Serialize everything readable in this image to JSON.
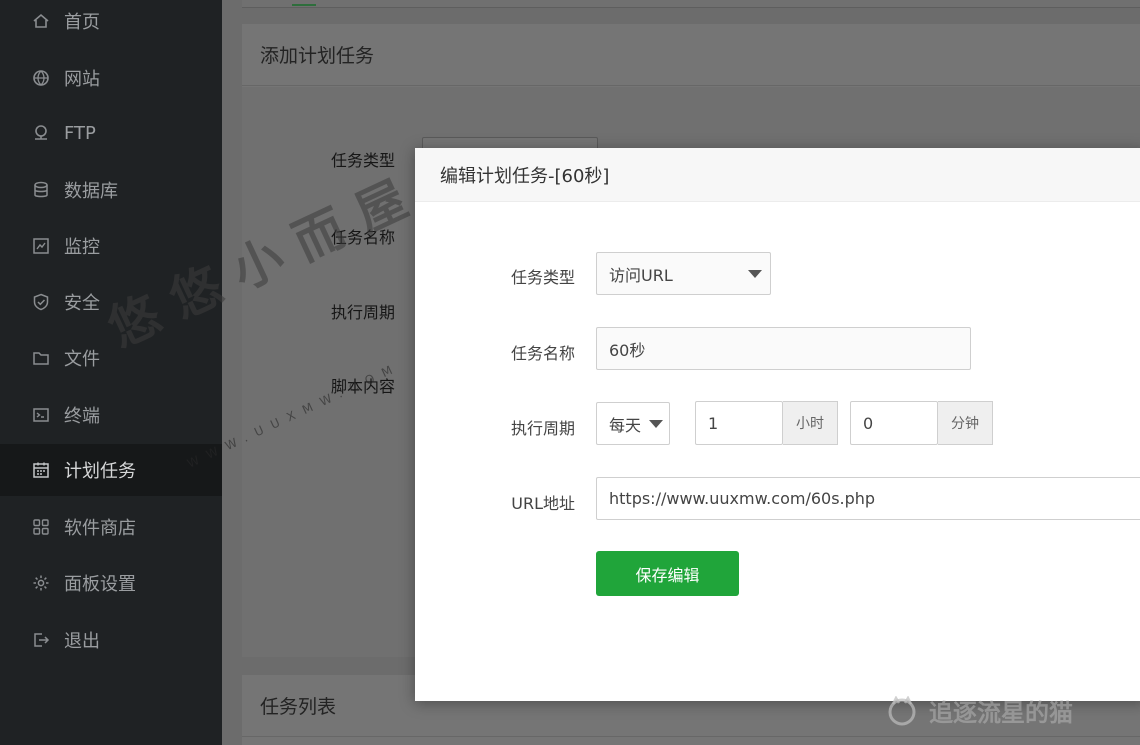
{
  "sidebar": {
    "items": [
      {
        "label": "首页",
        "icon": "home-icon"
      },
      {
        "label": "网站",
        "icon": "globe-icon"
      },
      {
        "label": "FTP",
        "icon": "ftp-icon"
      },
      {
        "label": "数据库",
        "icon": "database-icon"
      },
      {
        "label": "监控",
        "icon": "monitor-icon"
      },
      {
        "label": "安全",
        "icon": "shield-icon"
      },
      {
        "label": "文件",
        "icon": "folder-icon"
      },
      {
        "label": "终端",
        "icon": "terminal-icon"
      },
      {
        "label": "计划任务",
        "icon": "calendar-icon",
        "active": true
      },
      {
        "label": "软件商店",
        "icon": "grid-icon"
      },
      {
        "label": "面板设置",
        "icon": "gear-icon"
      },
      {
        "label": "退出",
        "icon": "logout-icon"
      }
    ]
  },
  "background": {
    "add_panel_title": "添加计划任务",
    "labels": [
      "任务类型",
      "任务名称",
      "执行周期",
      "脚本内容"
    ],
    "list_panel_title": "任务列表"
  },
  "modal": {
    "title": "编辑计划任务-[60秒]",
    "task_type_label": "任务类型",
    "task_type_value": "访问URL",
    "task_name_label": "任务名称",
    "task_name_value": "60秒",
    "cycle_label": "执行周期",
    "cycle_value": "每天",
    "hour_value": "1",
    "hour_unit": "小时",
    "minute_value": "0",
    "minute_unit": "分钟",
    "url_label": "URL地址",
    "url_value": "https://www.uuxmw.com/60s.php",
    "save_label": "保存编辑"
  },
  "watermarks": {
    "big": "悠悠小而屋",
    "small": "WWW.UUXMW.COM",
    "corner": "追逐流星的猫"
  },
  "colors": {
    "sidebar_bg": "#1f2224",
    "accent_green": "#20a53a",
    "modal_header_bg": "#f7f7f7"
  }
}
